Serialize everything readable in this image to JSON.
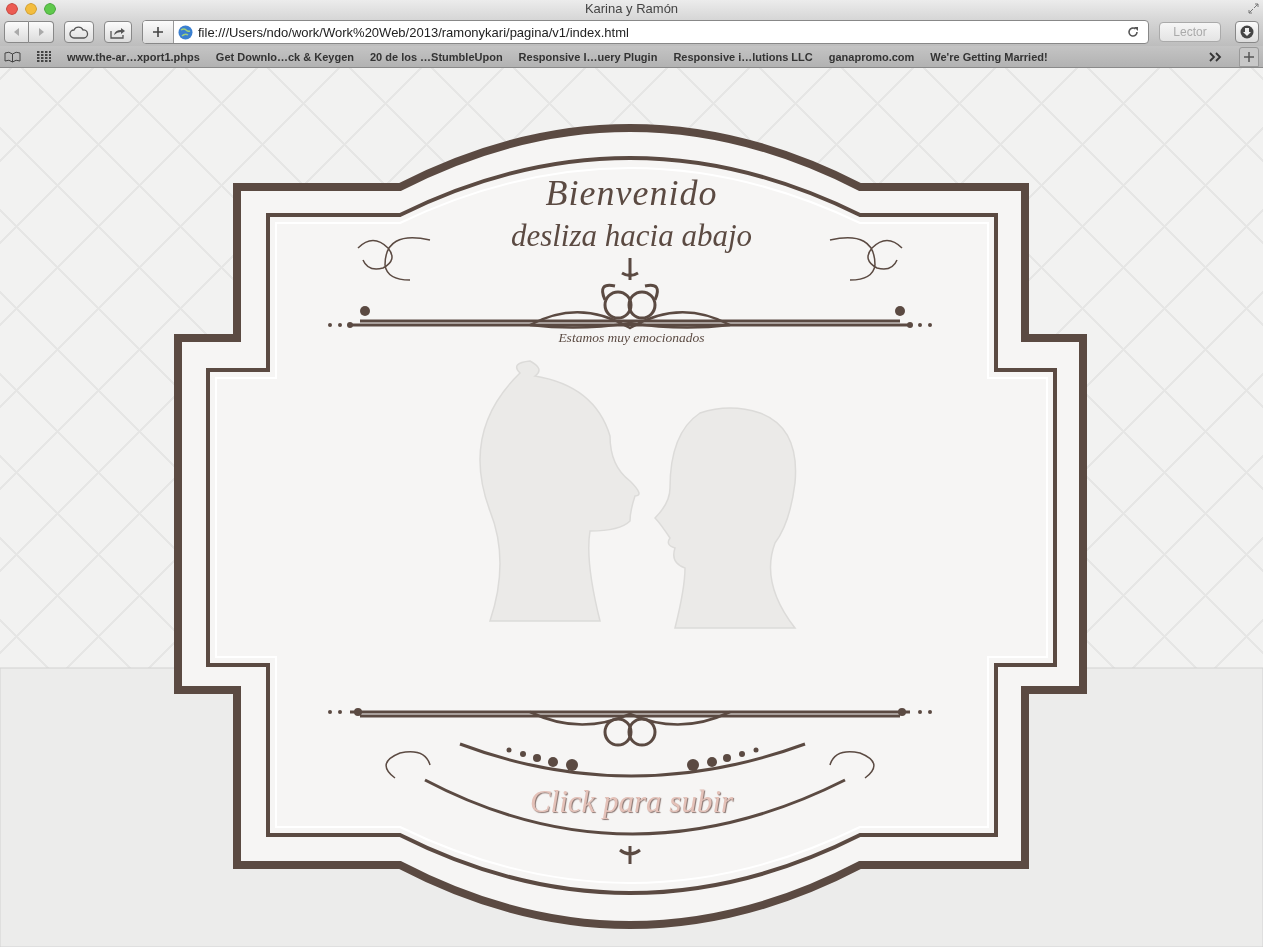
{
  "window": {
    "title": "Karina y Ramón"
  },
  "toolbar": {
    "address": "file:///Users/ndo/work/Work%20Web/2013/ramonykari/pagina/v1/index.html",
    "reader_button": {
      "label": "Lector",
      "disabled": true
    }
  },
  "bookmarks": [
    "www.the-ar…xport1.phps",
    "Get Downlo…ck & Keygen",
    "20 de los …StumbleUpon",
    "Responsive I…uery Plugin",
    "Responsive i…lutions LLC",
    "ganapromo.com",
    "We're Getting Married!"
  ],
  "page": {
    "heading": "Bienvenido",
    "subheading": "desliza hacia abajo",
    "tagline": "Estamos muy emocionados",
    "link": "Click para subir"
  }
}
